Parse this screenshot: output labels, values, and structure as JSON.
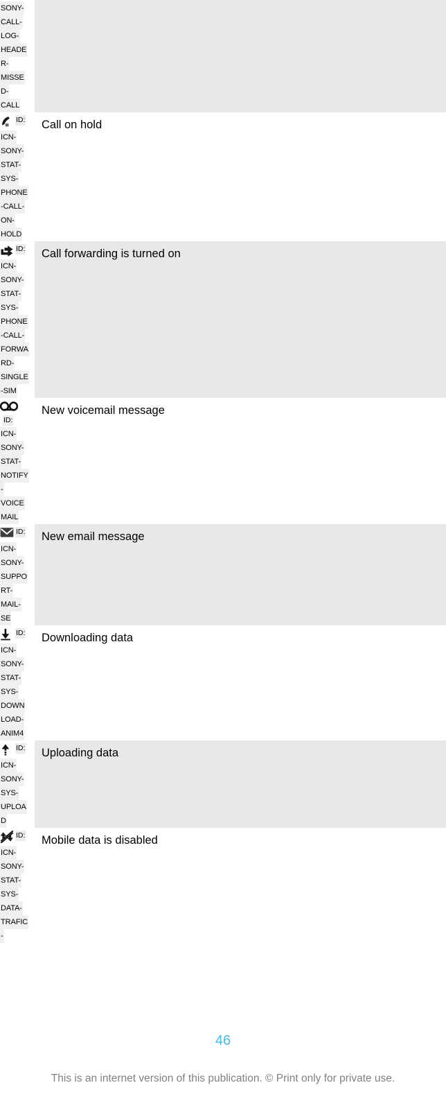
{
  "document": {
    "page_number": "46",
    "footer_note": "This is an internet version of this publication. © Print only for private use.",
    "id_prefix_label": "ID:",
    "accent_color": "#45bde2",
    "shaded_row_color": "#e8e8e8"
  },
  "rows": [
    {
      "icon": "missed-call-icon",
      "id_label": "ID:",
      "id_words": [
        "SONY-",
        "CALL-",
        "LOG-",
        "HEADE",
        "R-",
        "MISSE",
        "D-",
        "CALL"
      ],
      "id_full": "SONY-CALL-LOG-HEADER-MISSED-CALL",
      "description": "",
      "shaded": true,
      "partial_top": true
    },
    {
      "icon": "call-on-hold-icon",
      "id_label": "ID:",
      "id_words": [
        "ICN-",
        "SONY-",
        "STAT-",
        "SYS-",
        "PHONE",
        "-CALL-",
        "ON-",
        "HOLD"
      ],
      "id_full": "ICN-SONY-STAT-SYS-PHONE-CALL-ON-HOLD",
      "description": "Call on hold",
      "shaded": false,
      "partial_top": false
    },
    {
      "icon": "call-forward-icon",
      "id_label": "ID:",
      "id_words": [
        "ICN-",
        "SONY-",
        "STAT-",
        "SYS-",
        "PHONE",
        "-CALL-",
        "FORWA",
        "RD-",
        "SINGLE",
        "-SIM"
      ],
      "id_full": "ICN-SONY-STAT-SYS-PHONE-CALL-FORWARD-SINGLE-SIM",
      "description": "Call forwarding is turned on",
      "shaded": true,
      "partial_top": false
    },
    {
      "icon": "voicemail-icon",
      "id_label": "ID:",
      "id_words": [
        "ICN-",
        "SONY-",
        "STAT-",
        "NOTIFY",
        "-",
        "VOICE",
        "MAIL"
      ],
      "id_full": "ICN-SONY-STAT-NOTIFY-VOICEMAIL",
      "description": "New voicemail message",
      "shaded": false,
      "partial_top": false
    },
    {
      "icon": "email-icon",
      "id_label": "ID:",
      "id_words": [
        "ICN-",
        "SONY-",
        "SUPPO",
        "RT-",
        "MAIL-",
        "SE"
      ],
      "id_full": "ICN-SONY-SUPPORT-MAIL-SE",
      "description": "New email message",
      "shaded": true,
      "partial_top": false
    },
    {
      "icon": "download-icon",
      "id_label": "ID:",
      "id_words": [
        "ICN-",
        "SONY-",
        "STAT-",
        "SYS-",
        "DOWN",
        "LOAD-",
        "ANIM4"
      ],
      "id_full": "ICN-SONY-STAT-SYS-DOWNLOAD-ANIM4",
      "description": "Downloading data",
      "shaded": false,
      "partial_top": false
    },
    {
      "icon": "upload-icon",
      "id_label": "ID:",
      "id_words": [
        "ICN-",
        "SONY-",
        "SYS-",
        "UPLOA",
        "D"
      ],
      "id_full": "ICN-SONY-SYS-UPLOAD",
      "description": "Uploading data",
      "shaded": true,
      "partial_top": false
    },
    {
      "icon": "mobile-data-disabled-icon",
      "id_label": "ID:",
      "id_words": [
        "ICN-",
        "SONY-",
        "STAT-",
        "SYS-",
        "DATA-",
        "TRAFIC",
        "-"
      ],
      "id_full": "ICN-SONY-STAT-SYS-DATA-TRAFIC-",
      "description": "Mobile data is disabled",
      "shaded": false,
      "partial_top": false
    }
  ]
}
